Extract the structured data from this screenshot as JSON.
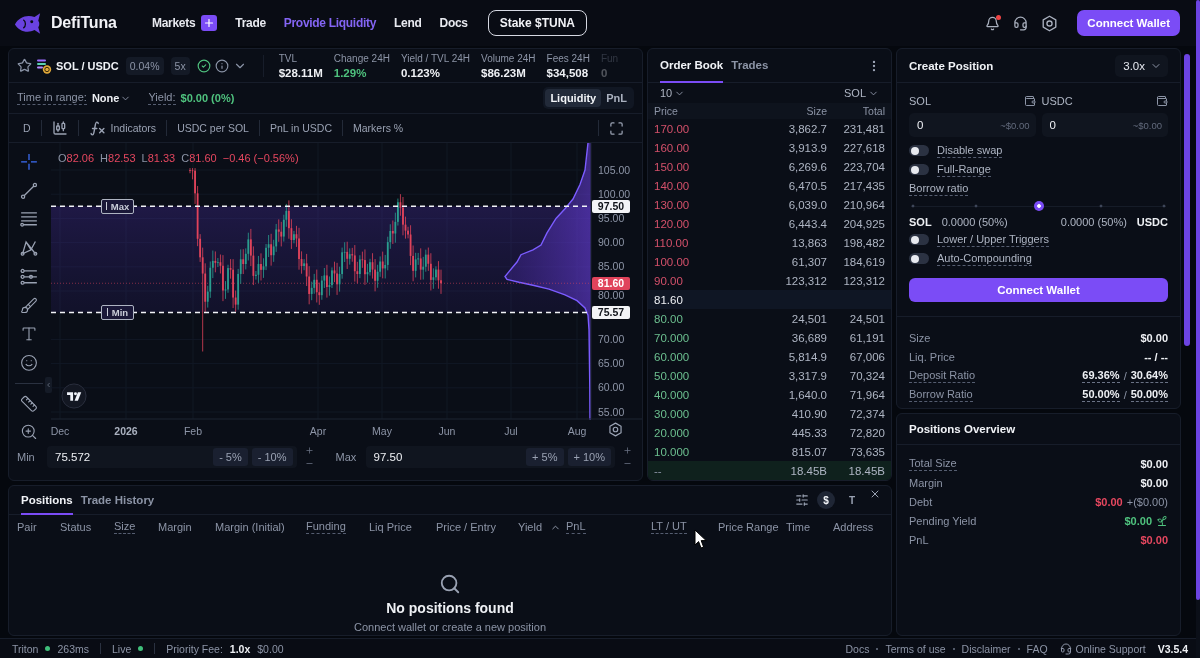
{
  "nav": {
    "brand": "DefiTuna",
    "links": [
      {
        "label": "Markets",
        "selected": false,
        "add_button": true
      },
      {
        "label": "Trade",
        "selected": false,
        "add_button": false
      },
      {
        "label": "Provide Liquidity",
        "selected": true,
        "add_button": false
      },
      {
        "label": "Lend",
        "selected": false,
        "add_button": false
      },
      {
        "label": "Docs",
        "selected": false,
        "add_button": false
      }
    ],
    "stake_button": "Stake $TUNA",
    "notifications_unread": true,
    "connect_button": "Connect Wallet"
  },
  "market": {
    "favorite": false,
    "pair": "SOL / USDC",
    "fee_tier": "0.04%",
    "max_leverage": "5x",
    "verified": true,
    "stats": [
      {
        "label": "TVL",
        "value": "$28.11M",
        "kind": "neutral",
        "cut": false
      },
      {
        "label": "Change 24H",
        "value": "1.29%",
        "kind": "positive",
        "cut": false
      },
      {
        "label": "Yield / TVL 24H",
        "value": "0.123%",
        "kind": "neutral",
        "cut": false
      },
      {
        "label": "Volume 24H",
        "value": "$86.23M",
        "kind": "neutral",
        "cut": false
      },
      {
        "label": "Fees 24H",
        "value": "$34,508",
        "kind": "neutral",
        "cut": false
      },
      {
        "label": "Fun",
        "value": "0",
        "kind": "neutral",
        "cut": true
      }
    ]
  },
  "chart_filters": {
    "time_in_range": {
      "label": "Time in range:",
      "value": "None"
    },
    "yield": {
      "label": "Yield:",
      "value": "$0.00 (0%)"
    },
    "view_toggle": [
      {
        "label": "Liquidity",
        "selected": true
      },
      {
        "label": "PnL",
        "selected": false
      }
    ]
  },
  "chart_toolbar": {
    "interval": "D",
    "items": [
      {
        "label": "Indicators",
        "kind": "indicators"
      },
      {
        "label": "USDC per SOL",
        "kind": "option"
      },
      {
        "label": "PnL in USDC",
        "kind": "option"
      },
      {
        "label": "Markers %",
        "kind": "option"
      }
    ]
  },
  "chart": {
    "legend": [
      {
        "key": "O",
        "value": "82.06"
      },
      {
        "key": "H",
        "value": "82.53"
      },
      {
        "key": "L",
        "value": "81.33"
      },
      {
        "key": "C",
        "value": "81.60"
      }
    ],
    "legend_falling": true,
    "change": "−0.46 (−0.56%)",
    "price_axis": [
      "105.00",
      "100.00",
      "95.00",
      "90.00",
      "85.00",
      "80.00",
      "70.00",
      "65.00",
      "60.00",
      "55.00"
    ],
    "time_axis": [
      {
        "label": "Dec",
        "kind": "month"
      },
      {
        "label": "2026",
        "kind": "year"
      },
      {
        "label": "Feb",
        "kind": "month"
      },
      {
        "label": "Apr",
        "kind": "month"
      },
      {
        "label": "May",
        "kind": "month"
      },
      {
        "label": "Jun",
        "kind": "month"
      },
      {
        "label": "Jul",
        "kind": "month"
      },
      {
        "label": "Aug",
        "kind": "month"
      }
    ],
    "range_lines": [
      {
        "label": "Max",
        "price": "97.50"
      },
      {
        "label": "Min",
        "price": "75.57"
      }
    ],
    "last_price": "81.60"
  },
  "range_inputs": [
    {
      "label": "Min",
      "value": "75.572",
      "steps": [
        "- 5%",
        "- 10%"
      ]
    },
    {
      "label": "Max",
      "value": "97.50",
      "steps": [
        "+ 5%",
        "+ 10%"
      ]
    }
  ],
  "order_book": {
    "tabs": [
      {
        "label": "Order Book",
        "selected": true
      },
      {
        "label": "Trades",
        "selected": false
      }
    ],
    "depth": "10",
    "unit": "SOL",
    "columns": [
      "Price",
      "Size",
      "Total"
    ],
    "rows": [
      {
        "kind": "ask",
        "price": "170.00",
        "size": "3,862.7",
        "total": "231,481"
      },
      {
        "kind": "ask",
        "price": "160.00",
        "size": "3,913.9",
        "total": "227,618"
      },
      {
        "kind": "ask",
        "price": "150.00",
        "size": "6,269.6",
        "total": "223,704"
      },
      {
        "kind": "ask",
        "price": "140.00",
        "size": "6,470.5",
        "total": "217,435"
      },
      {
        "kind": "ask",
        "price": "130.00",
        "size": "6,039.0",
        "total": "210,964"
      },
      {
        "kind": "ask",
        "price": "120.00",
        "size": "6,443.4",
        "total": "204,925"
      },
      {
        "kind": "ask",
        "price": "110.00",
        "size": "13,863",
        "total": "198,482"
      },
      {
        "kind": "ask",
        "price": "100.00",
        "size": "61,307",
        "total": "184,619"
      },
      {
        "kind": "ask",
        "price": "90.00",
        "size": "123,312",
        "total": "123,312"
      },
      {
        "kind": "mid",
        "price": "81.60"
      },
      {
        "kind": "bid",
        "price": "80.00",
        "size": "24,501",
        "total": "24,501"
      },
      {
        "kind": "bid",
        "price": "70.000",
        "size": "36,689",
        "total": "61,191"
      },
      {
        "kind": "bid",
        "price": "60.000",
        "size": "5,814.9",
        "total": "67,006"
      },
      {
        "kind": "bid",
        "price": "50.000",
        "size": "3,317.9",
        "total": "70,324"
      },
      {
        "kind": "bid",
        "price": "40.000",
        "size": "1,640.0",
        "total": "71,964"
      },
      {
        "kind": "bid",
        "price": "30.000",
        "size": "410.90",
        "total": "72,374"
      },
      {
        "kind": "bid",
        "price": "20.000",
        "size": "445.33",
        "total": "72,820"
      },
      {
        "kind": "bid",
        "price": "10.000",
        "size": "815.07",
        "total": "73,635"
      },
      {
        "kind": "sum",
        "price": "--",
        "size": "18.45B",
        "total": "18.45B"
      }
    ]
  },
  "create_position": {
    "title": "Create Position",
    "leverage": "3.0x",
    "inputs": [
      {
        "token": "SOL",
        "value": "0",
        "usd": "~$0.00"
      },
      {
        "token": "USDC",
        "value": "0",
        "usd": "~$0.00"
      }
    ],
    "range_toggles": [
      {
        "label": "Disable swap",
        "on": false
      },
      {
        "label": "Full-Range",
        "on": false
      }
    ],
    "borrow_ratio": {
      "label": "Borrow ratio",
      "level": 0.5,
      "left": {
        "token": "SOL",
        "amount": "0.0000 (50%)"
      },
      "right": {
        "token": "USDC",
        "amount": "0.0000 (50%)"
      }
    },
    "extra_toggles": [
      {
        "label": "Lower / Upper Triggers",
        "on": false
      },
      {
        "label": "Auto-Compounding",
        "on": false
      }
    ],
    "button": "Connect Wallet",
    "summary": [
      {
        "label": "Size",
        "dashed": false,
        "parts": [
          {
            "text": "$0.00",
            "kind": "neutral",
            "dashed": false
          }
        ]
      },
      {
        "label": "Liq. Price",
        "dashed": false,
        "parts": [
          {
            "text": "-- / --",
            "kind": "neutral",
            "dashed": false
          }
        ]
      },
      {
        "label": "Deposit Ratio",
        "dashed": true,
        "parts": [
          {
            "text": "69.36%",
            "kind": "neutral",
            "dashed": true
          },
          {
            "text": "/",
            "kind": "muted",
            "dashed": false
          },
          {
            "text": "30.64%",
            "kind": "neutral",
            "dashed": true
          }
        ]
      },
      {
        "label": "Borrow Ratio",
        "dashed": true,
        "parts": [
          {
            "text": "50.00%",
            "kind": "neutral",
            "dashed": true
          },
          {
            "text": "/",
            "kind": "muted",
            "dashed": false
          },
          {
            "text": "50.00%",
            "kind": "neutral",
            "dashed": true
          }
        ]
      }
    ]
  },
  "positions_overview": {
    "title": "Positions Overview",
    "rows": [
      {
        "label": "Total Size",
        "dashed": true,
        "claimable": false,
        "parts": [
          {
            "text": "$0.00",
            "kind": "neutral",
            "dashed": false
          }
        ]
      },
      {
        "label": "Margin",
        "dashed": false,
        "claimable": false,
        "parts": [
          {
            "text": "$0.00",
            "kind": "neutral",
            "dashed": false
          }
        ]
      },
      {
        "label": "Debt",
        "dashed": false,
        "claimable": false,
        "parts": [
          {
            "text": "$0.00",
            "kind": "negative",
            "dashed": false
          },
          {
            "text": "+($0.00)",
            "kind": "muted",
            "dashed": false
          }
        ]
      },
      {
        "label": "Pending Yield",
        "dashed": false,
        "claimable": true,
        "parts": [
          {
            "text": "$0.00",
            "kind": "positive",
            "dashed": false
          }
        ]
      },
      {
        "label": "PnL",
        "dashed": false,
        "claimable": false,
        "parts": [
          {
            "text": "$0.00",
            "kind": "negative",
            "dashed": false
          }
        ]
      }
    ]
  },
  "positions": {
    "tabs": [
      {
        "label": "Positions",
        "selected": true
      },
      {
        "label": "Trade History",
        "selected": false
      }
    ],
    "currency_toggle": [
      {
        "label": "$",
        "selected": true
      },
      {
        "label": "T",
        "selected": false
      }
    ],
    "columns": [
      {
        "label": "Pair",
        "dashed": false,
        "sorted": false
      },
      {
        "label": "Status",
        "dashed": false,
        "sorted": false
      },
      {
        "label": "Size",
        "dashed": true,
        "sorted": false
      },
      {
        "label": "Margin",
        "dashed": false,
        "sorted": false
      },
      {
        "label": "Margin (Initial)",
        "dashed": false,
        "sorted": false
      },
      {
        "label": "Funding",
        "dashed": true,
        "sorted": false
      },
      {
        "label": "Liq Price",
        "dashed": false,
        "sorted": false
      },
      {
        "label": "Price / Entry",
        "dashed": false,
        "sorted": false
      },
      {
        "label": "Yield",
        "dashed": false,
        "sorted": true
      },
      {
        "label": "PnL",
        "dashed": true,
        "sorted": false
      },
      {
        "label": "LT / UT",
        "dashed": true,
        "sorted": false
      },
      {
        "label": "Price Range",
        "dashed": false,
        "sorted": false
      },
      {
        "label": "Time",
        "dashed": false,
        "sorted": false
      },
      {
        "label": "Address",
        "dashed": false,
        "sorted": false
      }
    ],
    "empty": {
      "title": "No positions found",
      "hint": "Connect wallet or create a new position"
    }
  },
  "status_bar": {
    "rpc": {
      "name": "Triton",
      "latency": "263ms",
      "connected": true
    },
    "live": {
      "label": "Live",
      "on": true
    },
    "priority_fee": {
      "label": "Priority Fee:",
      "multiplier": "1.0x",
      "value": "$0.00"
    },
    "links": [
      "Docs",
      "Terms of use",
      "Disclaimer",
      "FAQ"
    ],
    "support": "Online Support",
    "version": "V3.5.4"
  }
}
